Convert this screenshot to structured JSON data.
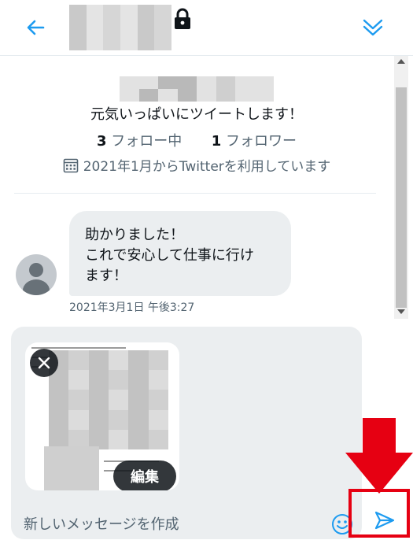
{
  "header": {
    "back_icon": "arrow-left-icon",
    "lock_icon": "lock-icon",
    "collapse_icon": "double-chevron-down-icon",
    "accent_color": "#1d9bf0"
  },
  "profile": {
    "bio": "元気いっぱいにツイートします！",
    "following_count": "3",
    "following_label": "フォロー中",
    "followers_count": "1",
    "followers_label": "フォロワー",
    "joined": "2021年1月からTwitterを利用しています"
  },
  "message": {
    "lines": [
      "助かりました！",
      "これで安心して仕事に行け",
      "ます！"
    ],
    "timestamp": "2021年3月1日 午後3:27"
  },
  "composer": {
    "edit_label": "編集",
    "placeholder": "新しいメッセージを作成",
    "emoji_icon": "emoji-icon",
    "send_icon": "send-icon"
  },
  "annotation": {
    "highlight_color": "#e60012"
  }
}
